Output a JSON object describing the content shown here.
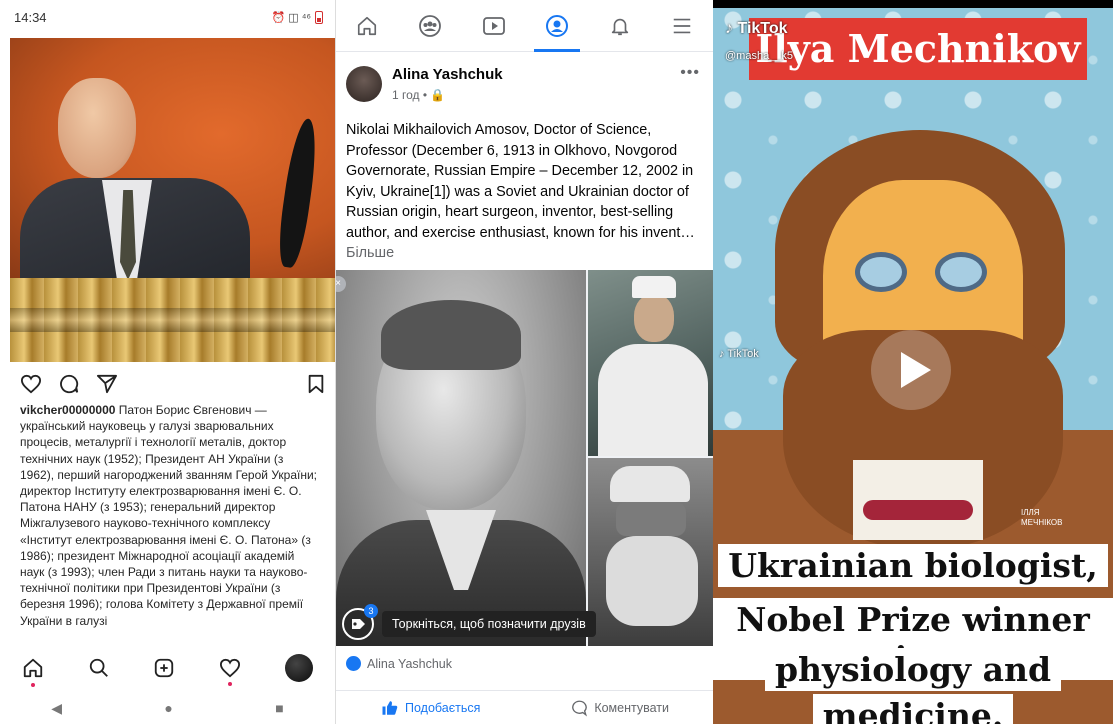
{
  "instagram": {
    "status_time": "14:34",
    "status_icons_text": "⏰ ◫ ⁴⁶",
    "username": "vikcher00000000",
    "caption": "Патон Борис Євгенович — український науковець у галузі зварювальних процесів, металургії і технології металів, доктор технічних наук (1952); Президент АН України (з 1962), перший нагороджений званням Герой України; директор Інституту електрозварювання імені Є. О. Патона НАНУ (з 1953); генеральний директор Міжгалузевого науково-технічного комплексу «Інститут електрозварювання імені Є. О. Патона» (з 1986); президент Міжнародної асоціації академій наук (з 1993); член Ради з питань науки та науково-технічної політики при Президентові України (з березня 1996); голова Комітету з Державної премії України в галузі",
    "actions": {
      "like": "heart-icon",
      "comment": "comment-icon",
      "share": "send-icon",
      "save": "bookmark-icon"
    },
    "nav": [
      "home-icon",
      "search-icon",
      "add-icon",
      "activity-icon",
      "profile-avatar"
    ],
    "system_nav": {
      "back": "◀",
      "home": "●",
      "recents": "■"
    }
  },
  "facebook": {
    "nav": [
      "home-icon",
      "groups-icon",
      "watch-icon",
      "profile-icon",
      "notifications-icon",
      "menu-icon"
    ],
    "active_tab": "profile-icon",
    "author": "Alina Yashchuk",
    "meta": "1 год • 🔒",
    "more": "•••",
    "post_text": "Nikolai Mikhailovich Amosov, Doctor of Science, Professor (December 6, 1913 in Olkhovo, Novgorod Governorate, Russian Empire – December 12, 2002 in Kyiv, Ukraine[1]) was a Soviet and Ukrainian doctor of Russian origin, heart surgeon, inventor, best-selling author, and exercise enthusiast, known for his invent…",
    "see_more": "Більше",
    "close": "×",
    "tag_badge": "3",
    "tag_hint": "Торкніться, щоб позначити друзів",
    "reactor": "Alina Yashchuk",
    "like_label": "Подобається",
    "comment_label": "Коментувати",
    "accent": "#1877f2"
  },
  "tiktok": {
    "title": "Ilya Mechnikov",
    "logo": "TikTok",
    "handle": "@masha__k5",
    "logo_small": "TikTok",
    "signature": "ІЛЛЯ\nМЕЧНІКОВ",
    "caption_lines": [
      "Ukrainian biologist,",
      "Nobel Prize winner in",
      "physiology and",
      "medicine."
    ],
    "title_color": "#e23a32"
  }
}
